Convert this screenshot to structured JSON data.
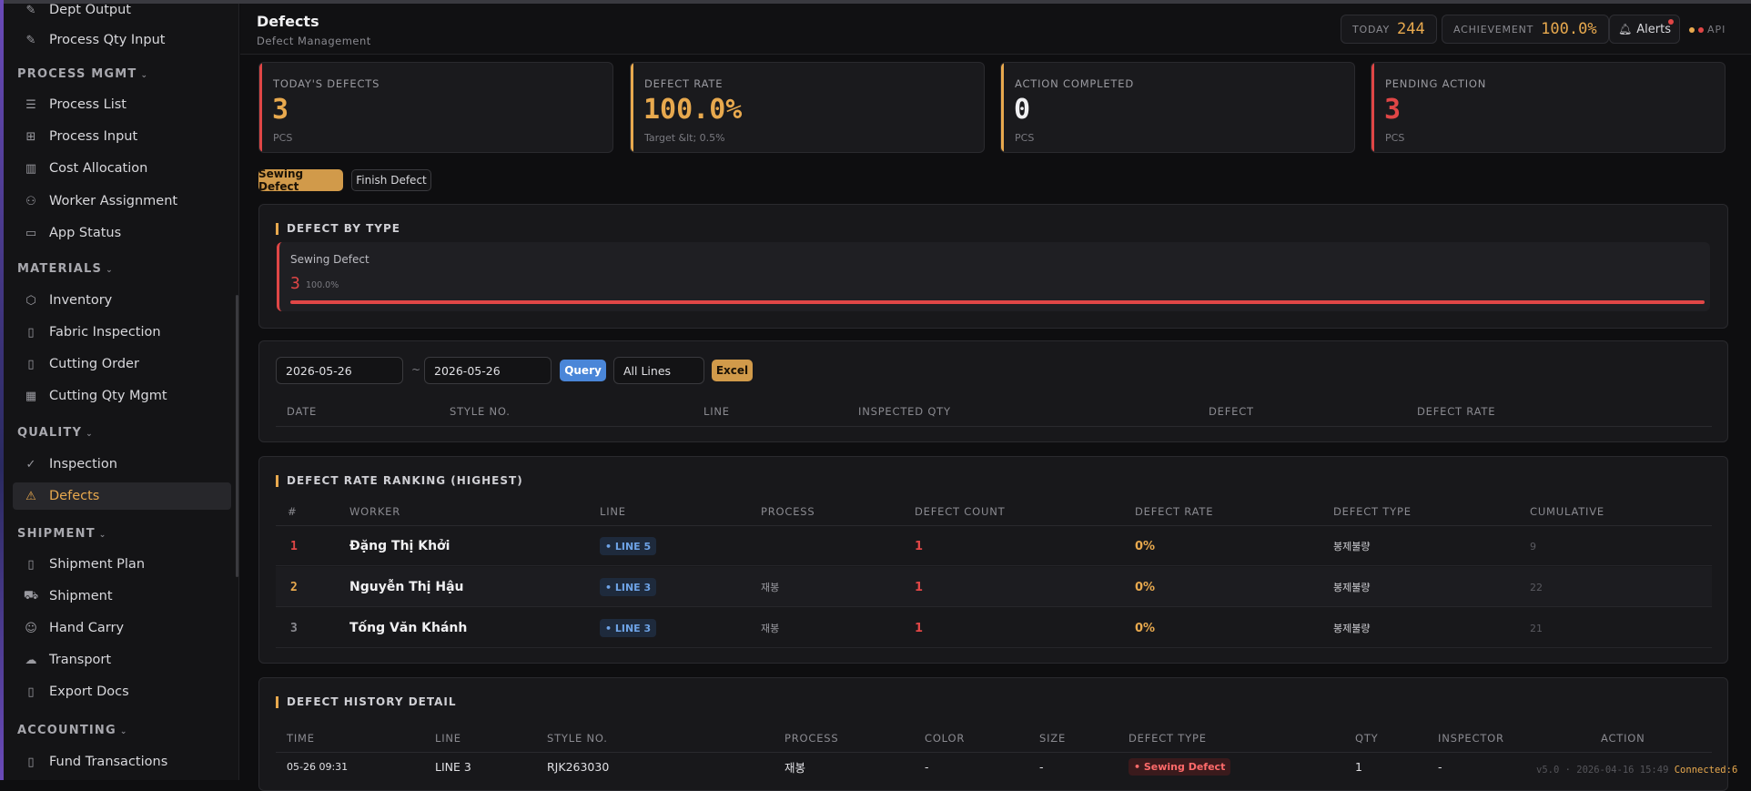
{
  "sidebar": {
    "items_top": [
      {
        "label": "Dept Output",
        "icon": "pencil-icon"
      },
      {
        "label": "Process Qty Input",
        "icon": "pencil-icon"
      }
    ],
    "sections": [
      {
        "title": "PROCESS MGMT",
        "items": [
          {
            "label": "Process List",
            "icon": "list-icon"
          },
          {
            "label": "Process Input",
            "icon": "plus-square-icon"
          },
          {
            "label": "Cost Allocation",
            "icon": "bar-chart-icon"
          },
          {
            "label": "Worker Assignment",
            "icon": "users-icon"
          },
          {
            "label": "App Status",
            "icon": "monitor-icon"
          }
        ]
      },
      {
        "title": "MATERIALS",
        "items": [
          {
            "label": "Inventory",
            "icon": "hexagon-icon"
          },
          {
            "label": "Fabric Inspection",
            "icon": "document-icon"
          },
          {
            "label": "Cutting Order",
            "icon": "document-icon"
          },
          {
            "label": "Cutting Qty Mgmt",
            "icon": "grid-icon"
          }
        ]
      },
      {
        "title": "QUALITY",
        "items": [
          {
            "label": "Inspection",
            "icon": "check-circle-icon"
          },
          {
            "label": "Defects",
            "icon": "warning-icon"
          }
        ]
      },
      {
        "title": "SHIPMENT",
        "items": [
          {
            "label": "Shipment Plan",
            "icon": "clipboard-icon"
          },
          {
            "label": "Shipment",
            "icon": "truck-icon"
          },
          {
            "label": "Hand Carry",
            "icon": "user-icon"
          },
          {
            "label": "Transport",
            "icon": "cloud-icon"
          },
          {
            "label": "Export Docs",
            "icon": "document-icon"
          }
        ]
      },
      {
        "title": "ACCOUNTING",
        "items": [
          {
            "label": "Fund Transactions",
            "icon": "document-icon"
          }
        ]
      }
    ]
  },
  "header": {
    "title": "Defects",
    "subtitle": "Defect Management",
    "today_label": "TODAY",
    "today_value": "244",
    "achievement_label": "ACHIEVEMENT",
    "achievement_value": "100.0%",
    "alerts_label": "Alerts",
    "api_label": "API"
  },
  "stats": [
    {
      "label": "TODAY'S DEFECTS",
      "value": "3",
      "sub": "PCS",
      "color": "#e8a94e",
      "bar": "#e04646"
    },
    {
      "label": "DEFECT RATE",
      "value": "100.0%",
      "sub": "Target &lt; 0.5%",
      "color": "#e8a94e",
      "bar": "#e8a94e"
    },
    {
      "label": "ACTION COMPLETED",
      "value": "0",
      "sub": "PCS",
      "color": "#f0f0f2",
      "bar": "#e8a94e"
    },
    {
      "label": "PENDING ACTION",
      "value": "3",
      "sub": "PCS",
      "color": "#e04646",
      "bar": "#e04646"
    }
  ],
  "tabs": {
    "sewing": "Sewing Defect",
    "finish": "Finish Defect"
  },
  "defect_by_type": {
    "title": "DEFECT BY TYPE",
    "item_name": "Sewing Defect",
    "item_count": "3",
    "item_pct": "100.0%",
    "item_fraction": 1.0
  },
  "filter": {
    "date_from": "2026-05-26",
    "date_sep": "~",
    "date_to": "2026-05-26",
    "query_label": "Query",
    "line_select": "All Lines",
    "excel_label": "Excel",
    "columns": [
      "DATE",
      "STYLE NO.",
      "LINE",
      "INSPECTED QTY",
      "DEFECT",
      "DEFECT RATE"
    ]
  },
  "ranking": {
    "title": "DEFECT RATE RANKING (HIGHEST)",
    "columns": [
      "#",
      "WORKER",
      "LINE",
      "PROCESS",
      "DEFECT COUNT",
      "DEFECT RATE",
      "DEFECT TYPE",
      "CUMULATIVE"
    ],
    "rows": [
      {
        "rank": "1",
        "worker": "Đặng Thị Khởi",
        "line": "• LINE 5",
        "process": "",
        "count": "1",
        "rate": "0%",
        "type": "봉제불량",
        "cumulative": "9",
        "rank_color": "#e04646"
      },
      {
        "rank": "2",
        "worker": "Nguyễn Thị Hậu",
        "line": "• LINE 3",
        "process": "재봉",
        "count": "1",
        "rate": "0%",
        "type": "봉제불량",
        "cumulative": "22",
        "rank_color": "#e8a94e"
      },
      {
        "rank": "3",
        "worker": "Tống Văn Khánh",
        "line": "• LINE 3",
        "process": "재봉",
        "count": "1",
        "rate": "0%",
        "type": "봉제불량",
        "cumulative": "21",
        "rank_color": "#8a8a90"
      }
    ]
  },
  "history": {
    "title": "DEFECT HISTORY DETAIL",
    "columns": [
      "TIME",
      "LINE",
      "STYLE NO.",
      "PROCESS",
      "COLOR",
      "SIZE",
      "DEFECT TYPE",
      "QTY",
      "INSPECTOR",
      "ACTION"
    ],
    "row": {
      "time": "05-26 09:31",
      "line": "LINE 3",
      "style": "RJK263030",
      "process": "재봉",
      "color": "-",
      "size": "-",
      "type": "• Sewing Defect",
      "qty": "1",
      "inspector": "-"
    }
  },
  "footer": {
    "version": "v5.0 · 2026-04-16 15:49",
    "connected": "Connected:6"
  }
}
